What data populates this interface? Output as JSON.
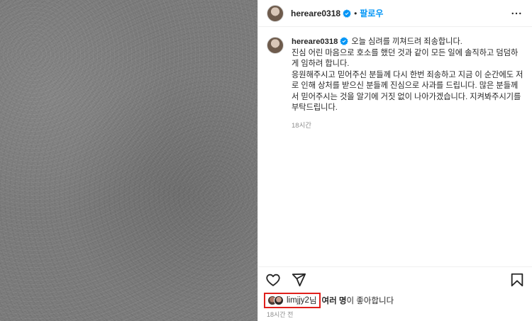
{
  "header": {
    "username": "hereare0318",
    "separator": "•",
    "follow_label": "팔로우"
  },
  "caption": {
    "username": "hereare0318",
    "text": "오늘 심려를 끼쳐드려 죄송합니다.\n진심 어린 마음으로 호소를 했던 것과 같이 모든 일에 솔직하고 덤덤하게 임하려 합니다.\n응원해주시고 믿어주신 분들께 다시 한번 죄송하고 지금 이 순간에도 저로 인해 상처를 받으신 분들께 진심으로 사과를 드립니다. 많은 분들께서 믿어주시는 것을 알기에 거짓 없이 나아가겠습니다. 지켜봐주시기를 부탁드립니다.",
    "time": "18시간"
  },
  "likes": {
    "first_liker": "limjjy2",
    "suffix1": "님 ",
    "others": "여러 명",
    "suffix2": "이 좋아합니다"
  },
  "post_time": "18시간 전",
  "icons": [
    "more-icon",
    "verified-icon",
    "heart-icon",
    "share-icon",
    "save-icon"
  ],
  "colors": {
    "follow": "#0095f6",
    "verified": "#0095f6",
    "highlight": "#e0201c"
  }
}
